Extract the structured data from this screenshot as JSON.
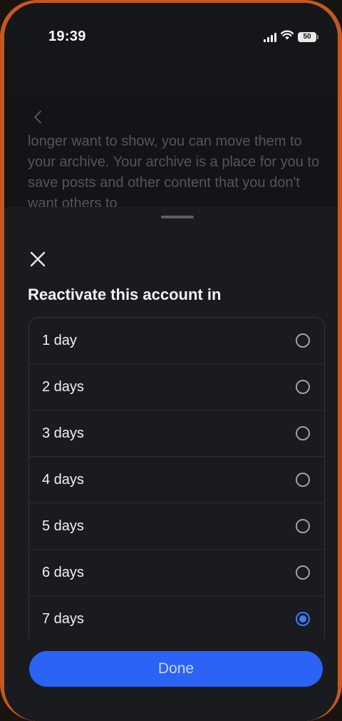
{
  "status_bar": {
    "time": "19:39",
    "battery": "50"
  },
  "background_page": {
    "text": "longer want to show, you can move them to your archive. Your archive is a place for you to save posts and other content that you don't want others to"
  },
  "sheet": {
    "title": "Reactivate this account in",
    "options": [
      {
        "label": "1 day",
        "selected": false
      },
      {
        "label": "2 days",
        "selected": false
      },
      {
        "label": "3 days",
        "selected": false
      },
      {
        "label": "4 days",
        "selected": false
      },
      {
        "label": "5 days",
        "selected": false
      },
      {
        "label": "6 days",
        "selected": false
      },
      {
        "label": "7 days",
        "selected": true
      }
    ],
    "done_label": "Done"
  },
  "colors": {
    "accent": "#2b63f5",
    "radio_selected": "#3d7bff",
    "frame": "#c6581d"
  }
}
